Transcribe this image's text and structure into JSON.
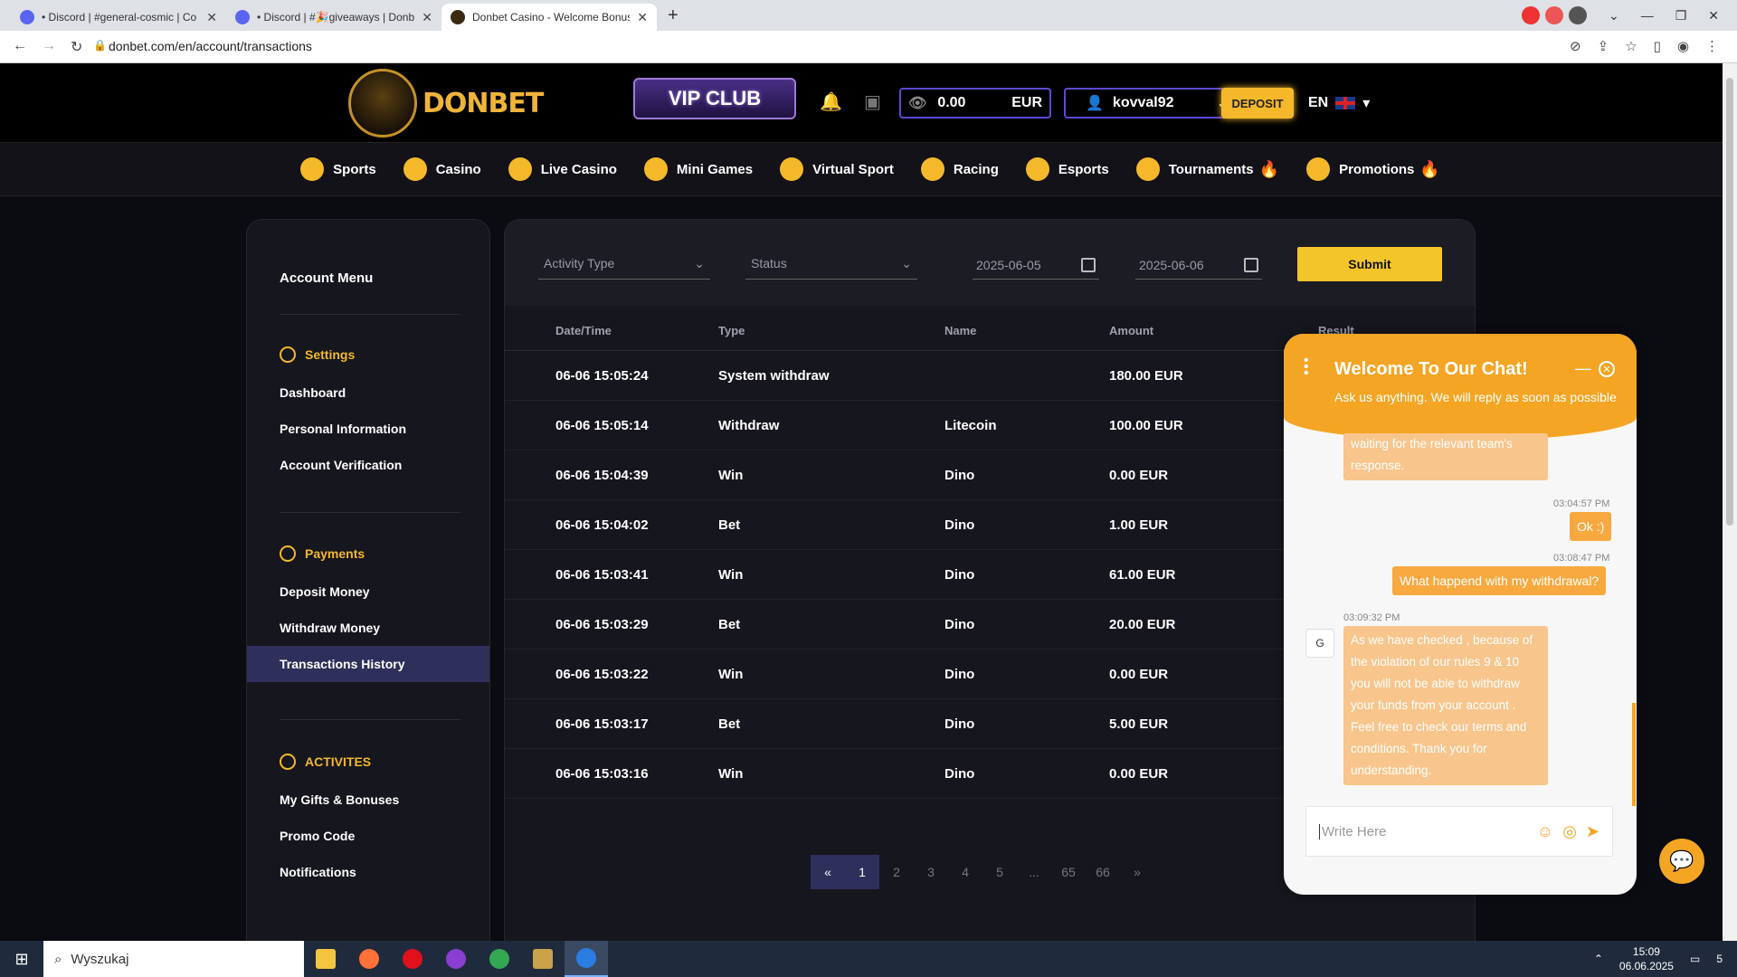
{
  "browser": {
    "tabs": [
      {
        "label": "• Discord | #general-cosmic | Co"
      },
      {
        "label": "• Discord | #🎉giveaways | Donb"
      },
      {
        "label": "Donbet Casino - Welcome Bonus"
      }
    ],
    "new_tab": "+",
    "url": "donbet.com/en/account/transactions"
  },
  "header": {
    "logo": "DONBET",
    "vip": "VIP CLUB",
    "balance": "0.00",
    "currency": "EUR",
    "username": "kovval92",
    "deposit": "DEPOSIT",
    "lang": "EN"
  },
  "nav": [
    {
      "label": "Sports"
    },
    {
      "label": "Casino"
    },
    {
      "label": "Live Casino"
    },
    {
      "label": "Mini Games"
    },
    {
      "label": "Virtual Sport"
    },
    {
      "label": "Racing"
    },
    {
      "label": "Esports"
    },
    {
      "label": "Tournaments"
    },
    {
      "label": "Promotions"
    }
  ],
  "account_menu": {
    "title": "Account Menu",
    "settings": {
      "head": "Settings",
      "items": [
        "Dashboard",
        "Personal Information",
        "Account Verification"
      ]
    },
    "payments": {
      "head": "Payments",
      "items": [
        "Deposit Money",
        "Withdraw Money",
        "Transactions History"
      ]
    },
    "activites": {
      "head": "ACTIVITES",
      "items": [
        "My Gifts & Bonuses",
        "Promo Code",
        "Notifications"
      ]
    }
  },
  "filters": {
    "activity_type": "Activity Type",
    "status": "Status",
    "date_from": "2025-06-05",
    "date_to": "2025-06-06",
    "submit": "Submit"
  },
  "table": {
    "headers": [
      "Date/Time",
      "Type",
      "Name",
      "Amount",
      "Result"
    ],
    "rows": [
      {
        "date": "06-06 15:05:24",
        "type": "System withdraw",
        "name": "",
        "amount": "180.00 EUR"
      },
      {
        "date": "06-06 15:05:14",
        "type": "Withdraw",
        "name": "Litecoin",
        "amount": "100.00 EUR"
      },
      {
        "date": "06-06 15:04:39",
        "type": "Win",
        "name": "Dino",
        "amount": "0.00 EUR"
      },
      {
        "date": "06-06 15:04:02",
        "type": "Bet",
        "name": "Dino",
        "amount": "1.00 EUR"
      },
      {
        "date": "06-06 15:03:41",
        "type": "Win",
        "name": "Dino",
        "amount": "61.00 EUR"
      },
      {
        "date": "06-06 15:03:29",
        "type": "Bet",
        "name": "Dino",
        "amount": "20.00 EUR"
      },
      {
        "date": "06-06 15:03:22",
        "type": "Win",
        "name": "Dino",
        "amount": "0.00 EUR"
      },
      {
        "date": "06-06 15:03:17",
        "type": "Bet",
        "name": "Dino",
        "amount": "5.00 EUR"
      },
      {
        "date": "06-06 15:03:16",
        "type": "Win",
        "name": "Dino",
        "amount": "0.00 EUR"
      }
    ]
  },
  "pagination": [
    "«",
    "1",
    "2",
    "3",
    "4",
    "5",
    "...",
    "65",
    "66",
    "»"
  ],
  "chat": {
    "title": "Welcome To Our Chat!",
    "subtitle": "Ask us anything. We will reply as soon as possible",
    "msg_partial": "waiting for the relevant team's response.",
    "ts1": "03:04:57 PM",
    "msg_ok": "Ok :)",
    "ts2": "03:08:47 PM",
    "msg_withdraw": "What happend with my withdrawal?",
    "ts3": "03:09:32 PM",
    "avatar": "G",
    "msg_reply": "As we have checked , because of the violation of our rules 9 & 10 you will not be able to withdraw your funds from your account . Feel free to check our terms and conditions. Thank you for understanding.",
    "input_placeholder": "Write Here"
  },
  "taskbar": {
    "search": "Wyszukaj",
    "time": "15:09",
    "date": "06.06.2025",
    "notif": "5"
  },
  "colors": {
    "accent": "#f4b82a",
    "chat": "#f4a524",
    "active_menu": "#2e2f5a"
  }
}
